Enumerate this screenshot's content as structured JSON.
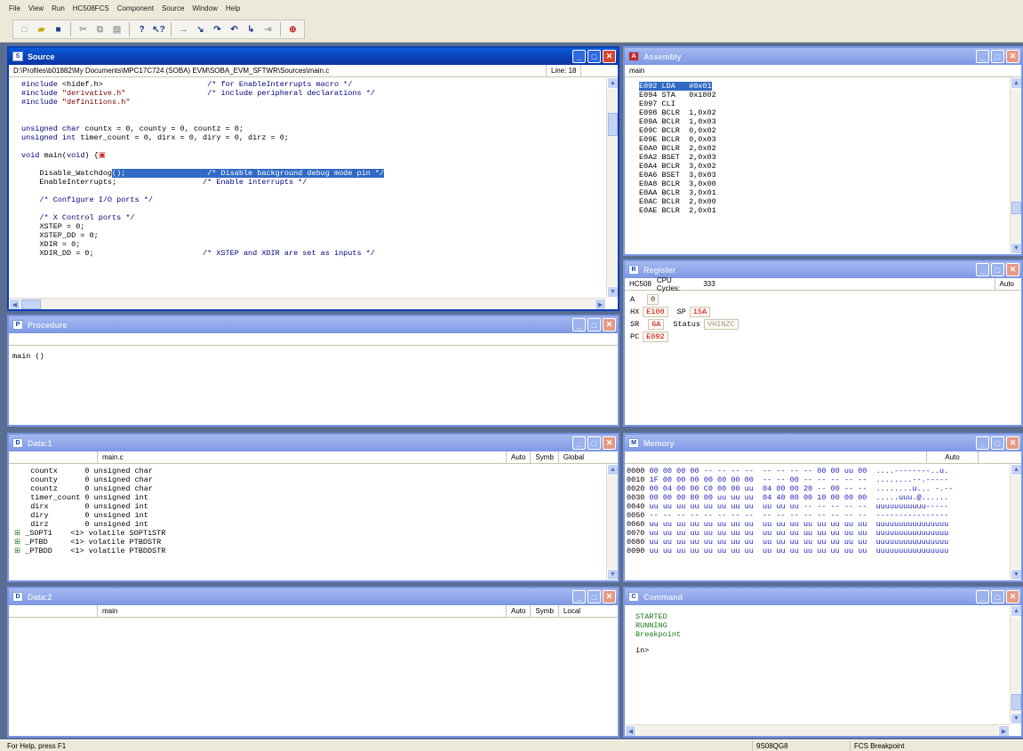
{
  "menu": [
    "File",
    "View",
    "Run",
    "HC508FCS",
    "Component",
    "Source",
    "Window",
    "Help"
  ],
  "windows": {
    "source": {
      "title": "Source",
      "path": "D:\\Profiles\\b01882\\My Documents\\MPC17C724 (SOBA) EVM\\SOBA_EVM_SFTWR\\Sources\\main.c",
      "line_label": "Line: 18"
    },
    "assembly": {
      "title": "Assembly",
      "function": "main",
      "rows": [
        {
          "addr": "E092",
          "op": "LDA",
          "arg": "#0x01",
          "highlight": true
        },
        {
          "addr": "E094",
          "op": "STA",
          "arg": "0x1802"
        },
        {
          "addr": "E097",
          "op": "CLI",
          "arg": ""
        },
        {
          "addr": "E098",
          "op": "BCLR",
          "arg": "1,0x02"
        },
        {
          "addr": "E09A",
          "op": "BCLR",
          "arg": "1,0x03"
        },
        {
          "addr": "E09C",
          "op": "BCLR",
          "arg": "0,0x02"
        },
        {
          "addr": "E09E",
          "op": "BCLR",
          "arg": "0,0x03"
        },
        {
          "addr": "E0A0",
          "op": "BCLR",
          "arg": "2,0x02"
        },
        {
          "addr": "E0A2",
          "op": "BSET",
          "arg": "2,0x03"
        },
        {
          "addr": "E0A4",
          "op": "BCLR",
          "arg": "3,0x02"
        },
        {
          "addr": "E0A6",
          "op": "BSET",
          "arg": "3,0x03"
        },
        {
          "addr": "E0A8",
          "op": "BCLR",
          "arg": "3,0x00"
        },
        {
          "addr": "E0AA",
          "op": "BCLR",
          "arg": "3,0x01"
        },
        {
          "addr": "E0AC",
          "op": "BCLR",
          "arg": "2,0x00"
        },
        {
          "addr": "E0AE",
          "op": "BCLR",
          "arg": "2,0x01"
        }
      ]
    },
    "procedure": {
      "title": "Procedure",
      "entry": "main ()"
    },
    "register": {
      "title": "Register",
      "cpu": "HC508",
      "cycles_label": "CPU Cycles:",
      "cycles": "333",
      "mode": "Auto",
      "A_label": "A",
      "A": "0",
      "HX_label": "HX",
      "HX": "E100",
      "SP_label": "SP",
      "SP": "15A",
      "SR_label": "SR",
      "SR": "6A",
      "status_label": "Status",
      "status": "VHINZC",
      "PC_label": "PC",
      "PC": "E092"
    },
    "data1": {
      "title": "Data:1",
      "file": "main.c",
      "mode": "Auto",
      "format": "Symb",
      "scope": "Global",
      "rows": [
        {
          "name": "countx",
          "value": "0 unsigned char"
        },
        {
          "name": "county",
          "value": "0 unsigned char"
        },
        {
          "name": "countz",
          "value": "0 unsigned char"
        },
        {
          "name": "timer_count",
          "value": "0 unsigned int"
        },
        {
          "name": "dirx",
          "value": "0 unsigned int"
        },
        {
          "name": "diry",
          "value": "0 unsigned int"
        },
        {
          "name": "dirz",
          "value": "0 unsigned int"
        },
        {
          "name": "_SOPT1",
          "value": "<1> volatile SOPT1STR",
          "expand": true
        },
        {
          "name": "_PTBD",
          "value": "<1> volatile PTBDSTR",
          "expand": true
        },
        {
          "name": "_PTBDD",
          "value": "<1> volatile PTBDDSTR",
          "expand": true
        }
      ]
    },
    "memory": {
      "title": "Memory",
      "mode": "Auto",
      "rows": [
        {
          "addr": "0000",
          "hex": "00 00 00 00 -- -- -- --  -- -- -- -- 00 00 uu 00",
          "ascii": "....--------..u."
        },
        {
          "addr": "0010",
          "hex": "1F 00 00 00 00 00 00 00  -- -- 00 -- -- -- -- --",
          "ascii": "........--.-----"
        },
        {
          "addr": "0020",
          "hex": "00 04 00 00 C0 00 00 uu  04 00 00 20 -- 00 -- --",
          "ascii": "........u... -.--"
        },
        {
          "addr": "0030",
          "hex": "00 00 00 80 00 uu uu uu  04 40 80 00 10 00 00 00",
          "ascii": ".....uuu.@......"
        },
        {
          "addr": "0040",
          "hex": "uu uu uu uu uu uu uu uu  uu uu uu -- -- -- -- --",
          "ascii": "uuuuuuuuuuu-----"
        },
        {
          "addr": "0050",
          "hex": "-- -- -- -- -- -- -- --  -- -- -- -- -- -- -- --",
          "ascii": "----------------"
        },
        {
          "addr": "0060",
          "hex": "uu uu uu uu uu uu uu uu  uu uu uu uu uu uu uu uu",
          "ascii": "uuuuuuuuuuuuuuuu"
        },
        {
          "addr": "0070",
          "hex": "uu uu uu uu uu uu uu uu  uu uu uu uu uu uu uu uu",
          "ascii": "uuuuuuuuuuuuuuuu"
        },
        {
          "addr": "0080",
          "hex": "uu uu uu uu uu uu uu uu  uu uu uu uu uu uu uu uu",
          "ascii": "uuuuuuuuuuuuuuuu"
        },
        {
          "addr": "0090",
          "hex": "uu uu uu uu uu uu uu uu  uu uu uu uu uu uu uu uu",
          "ascii": "uuuuuuuuuuuuuuuu"
        }
      ]
    },
    "data2": {
      "title": "Data:2",
      "file": "main",
      "mode": "Auto",
      "format": "Symb",
      "scope": "Local"
    },
    "command": {
      "title": "Command",
      "lines": [
        "STARTED",
        "RUNNING",
        "Breakpoint"
      ],
      "prompt": "in>"
    }
  },
  "status": {
    "help": "For Help, press F1",
    "target": "9S08QG8",
    "state": "FCS  Breakpoint"
  }
}
